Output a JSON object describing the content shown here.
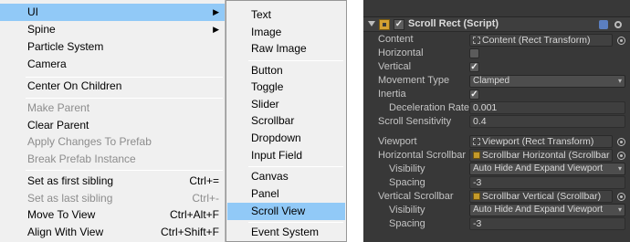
{
  "context_menu": {
    "items": [
      {
        "label": "UI",
        "submenu": true,
        "highlight": true
      },
      {
        "label": "Spine",
        "submenu": true
      },
      {
        "label": "Particle System"
      },
      {
        "label": "Camera"
      },
      {
        "label": "Center On Children"
      },
      {
        "label": "Make Parent",
        "disabled": true
      },
      {
        "label": "Clear Parent"
      },
      {
        "label": "Apply Changes To Prefab",
        "disabled": true
      },
      {
        "label": "Break Prefab Instance",
        "disabled": true
      },
      {
        "label": "Set as first sibling",
        "shortcut": "Ctrl+="
      },
      {
        "label": "Set as last sibling",
        "shortcut": "Ctrl+-",
        "disabled": true
      },
      {
        "label": "Move To View",
        "shortcut": "Ctrl+Alt+F"
      },
      {
        "label": "Align With View",
        "shortcut": "Ctrl+Shift+F"
      }
    ],
    "submenu_arrow": "▶"
  },
  "ui_submenu": {
    "items": [
      {
        "label": "Text"
      },
      {
        "label": "Image"
      },
      {
        "label": "Raw Image"
      },
      {
        "label": "Button"
      },
      {
        "label": "Toggle"
      },
      {
        "label": "Slider"
      },
      {
        "label": "Scrollbar"
      },
      {
        "label": "Dropdown"
      },
      {
        "label": "Input Field"
      },
      {
        "label": "Canvas"
      },
      {
        "label": "Panel"
      },
      {
        "label": "Scroll View",
        "highlight": true
      },
      {
        "label": "Event System"
      }
    ]
  },
  "inspector": {
    "component_title": "Scroll Rect (Script)",
    "enabled_check": "✓",
    "properties": {
      "content_label": "Content",
      "content_value": "Content (Rect Transform)",
      "horizontal_label": "Horizontal",
      "horizontal_checked": false,
      "vertical_label": "Vertical",
      "vertical_checked": true,
      "movement_type_label": "Movement Type",
      "movement_type_value": "Clamped",
      "inertia_label": "Inertia",
      "inertia_checked": true,
      "deceleration_rate_label": "Deceleration Rate",
      "deceleration_rate_value": "0.001",
      "scroll_sensitivity_label": "Scroll Sensitivity",
      "scroll_sensitivity_value": "0.4",
      "viewport_label": "Viewport",
      "viewport_value": "Viewport (Rect Transform)",
      "horizontal_scrollbar_label": "Horizontal Scrollbar",
      "horizontal_scrollbar_value": "Scrollbar Horizontal (Scrollbar",
      "h_visibility_label": "Visibility",
      "h_visibility_value": "Auto Hide And Expand Viewport",
      "h_spacing_label": "Spacing",
      "h_spacing_value": "-3",
      "vertical_scrollbar_label": "Vertical Scrollbar",
      "vertical_scrollbar_value": "Scrollbar Vertical (Scrollbar)",
      "v_visibility_label": "Visibility",
      "v_visibility_value": "Auto Hide And Expand Viewport",
      "v_spacing_label": "Spacing",
      "v_spacing_value": "-3"
    },
    "check_glyph": "✓",
    "dropdown_arrow": "▾"
  },
  "colors": {
    "menu_bg": "#f0f0f0",
    "menu_highlight": "#91c9f7",
    "menu_disabled_text": "#8d8d8d",
    "inspector_bg": "#383838",
    "inspector_text": "#c4c4c4",
    "component_icon": "#d4a032"
  }
}
